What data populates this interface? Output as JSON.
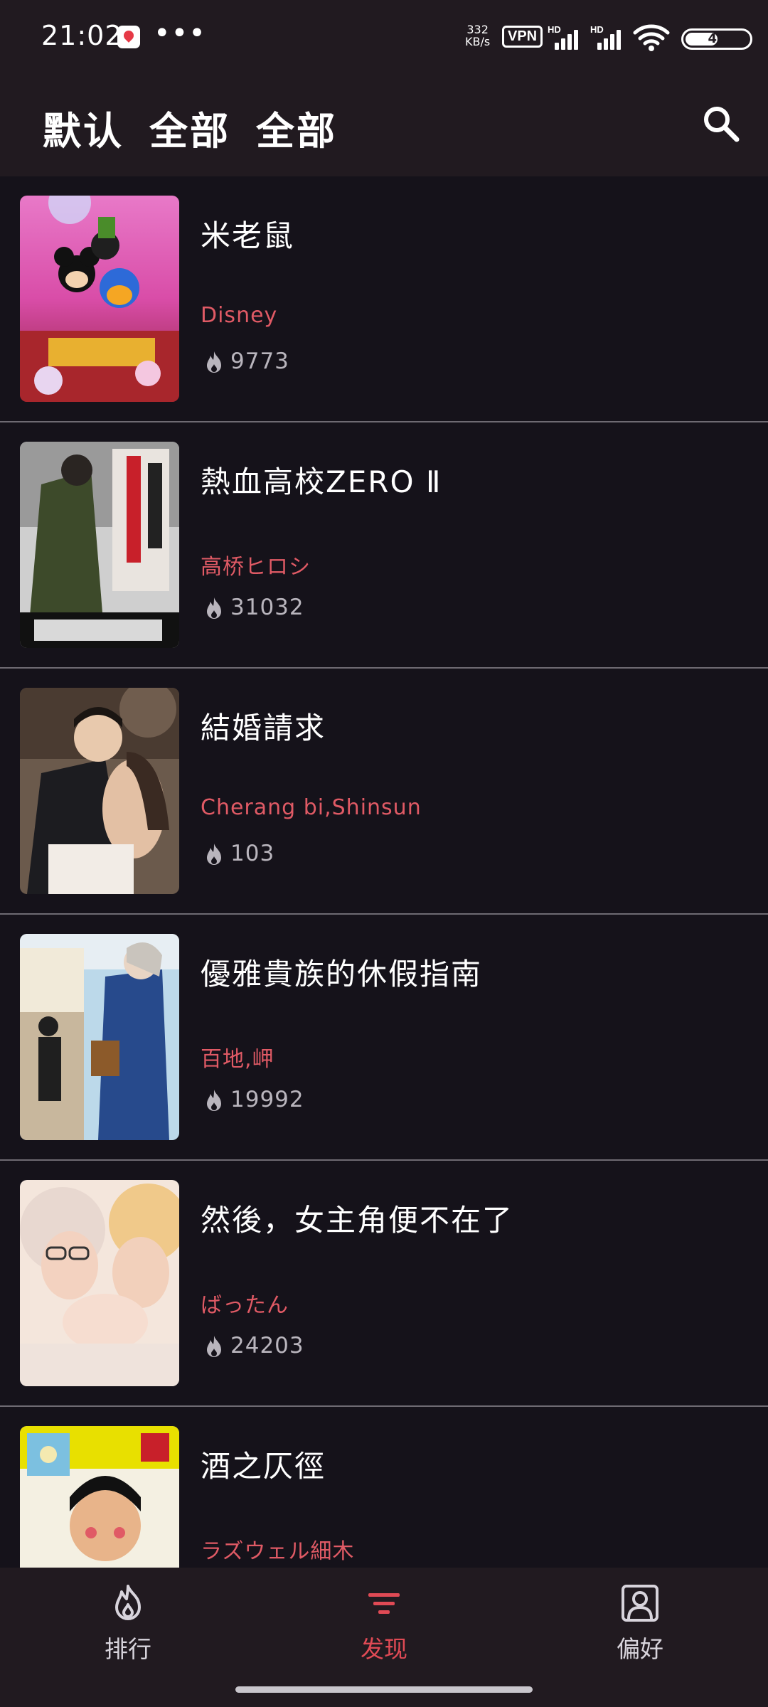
{
  "status_bar": {
    "time": "21:02",
    "dots": "•••",
    "net_speed_value": "332",
    "net_speed_unit": "KB/s",
    "vpn_label": "VPN",
    "hd_label": "HD",
    "battery_level": "47"
  },
  "header": {
    "filters": [
      "默认",
      "全部",
      "全部"
    ]
  },
  "list": {
    "items": [
      {
        "title": "米老鼠",
        "author": "Disney",
        "popularity": "9773"
      },
      {
        "title": "熱血高校ZERO Ⅱ",
        "author": "高桥ヒロシ",
        "popularity": "31032"
      },
      {
        "title": "結婚請求",
        "author": "Cherang bi,Shinsun",
        "popularity": "103"
      },
      {
        "title": "優雅貴族的休假指南",
        "author": "百地,岬",
        "popularity": "19992"
      },
      {
        "title": "然後，女主角便不在了",
        "author": "ばったん",
        "popularity": "24203"
      },
      {
        "title": "酒之仄徑",
        "author": "ラズウェル細木",
        "popularity": ""
      }
    ]
  },
  "bottom_nav": {
    "ranking_label": "排行",
    "discover_label": "发现",
    "preference_label": "偏好",
    "active": "discover"
  },
  "colors": {
    "accent": "#e04a55",
    "author": "#e05a65",
    "background": "#15121a",
    "bar": "#211a20"
  }
}
